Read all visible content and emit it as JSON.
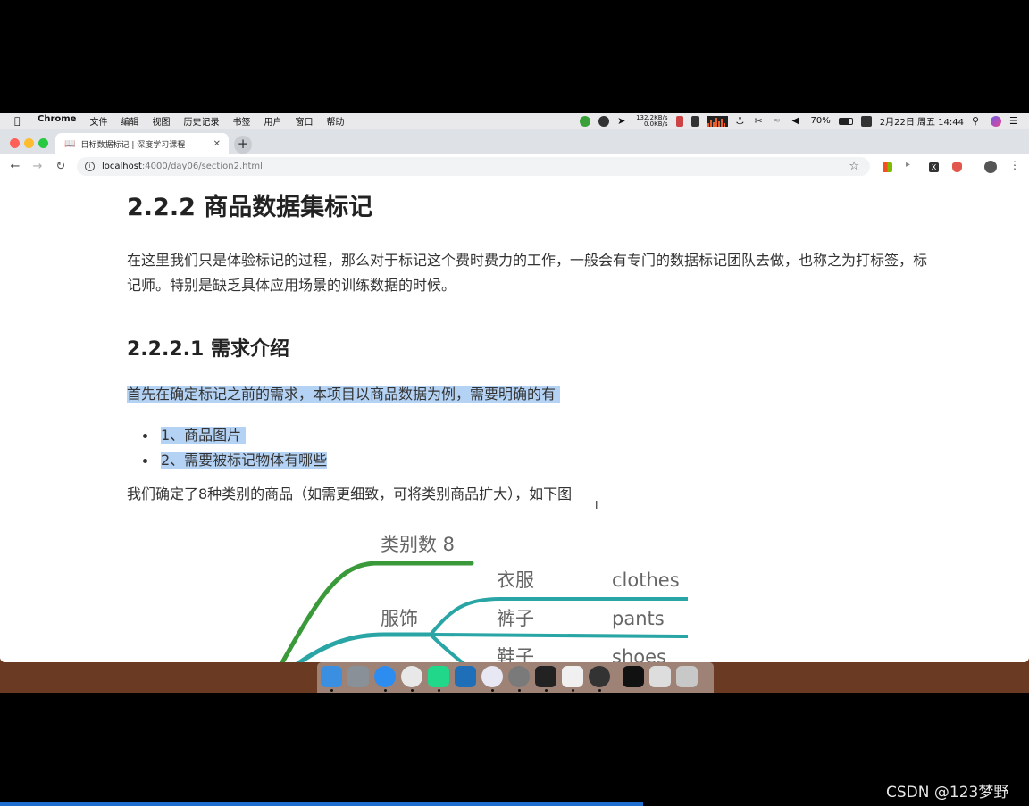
{
  "menubar": {
    "app": "Chrome",
    "items": [
      "文件",
      "编辑",
      "视图",
      "历史记录",
      "书签",
      "用户",
      "窗口",
      "帮助"
    ],
    "net_up": "132.2KB/s",
    "net_down": "0.0KB/s",
    "battery": "70%",
    "datetime": "2月22日 周五  14:44"
  },
  "browser": {
    "tab_title": "目标数据标记 | 深度学习课程",
    "url_host": "localhost",
    "url_path": ":4000/day06/section2.html"
  },
  "content": {
    "h2": "2.2.2 商品数据集标记",
    "para1": "在这里我们只是体验标记的过程，那么对于标记这个费时费力的工作，一般会有专门的数据标记团队去做，也称之为打标签，标记师。特别是缺乏具体应用场景的训练数据的时候。",
    "h3": "2.2.2.1 需求介绍",
    "para2": "首先在确定标记之前的需求，本项目以商品数据为例，需要明确的有",
    "list": [
      "1、商品图片",
      "2、需要被标记物体有哪些"
    ],
    "para3": "我们确定了8种类别的商品（如需更细致，可将类别商品扩大），如下图"
  },
  "mindmap": {
    "root": "类别数 8",
    "branch": "服饰",
    "leaves_cn": [
      "衣服",
      "裤子",
      "鞋子"
    ],
    "leaves_en": [
      "clothes",
      "pants",
      "shoes"
    ],
    "colors": {
      "green": "#3a9a3a",
      "teal": "#2aa5a5"
    }
  },
  "dock": {
    "icons": [
      "finder-icon",
      "launchpad-icon",
      "safari-icon",
      "chrome-icon",
      "pycharm-icon",
      "keynote-icon",
      "typora-icon",
      "system-preferences-icon",
      "terminal-icon",
      "typora-t-icon",
      "obs-icon",
      "window-thumb-1",
      "window-thumb-2",
      "trash-icon"
    ],
    "colors": [
      "#3b8fe0",
      "#8a9098",
      "#2d8cf0",
      "#e8e8e8",
      "#21d789",
      "#1f6fb8",
      "#e8e8f5",
      "#7a7a7a",
      "#222222",
      "#f0f0f0",
      "#333333",
      "#111111",
      "#dddddd",
      "#c8c8c8"
    ]
  },
  "watermark": "CSDN @123梦野"
}
